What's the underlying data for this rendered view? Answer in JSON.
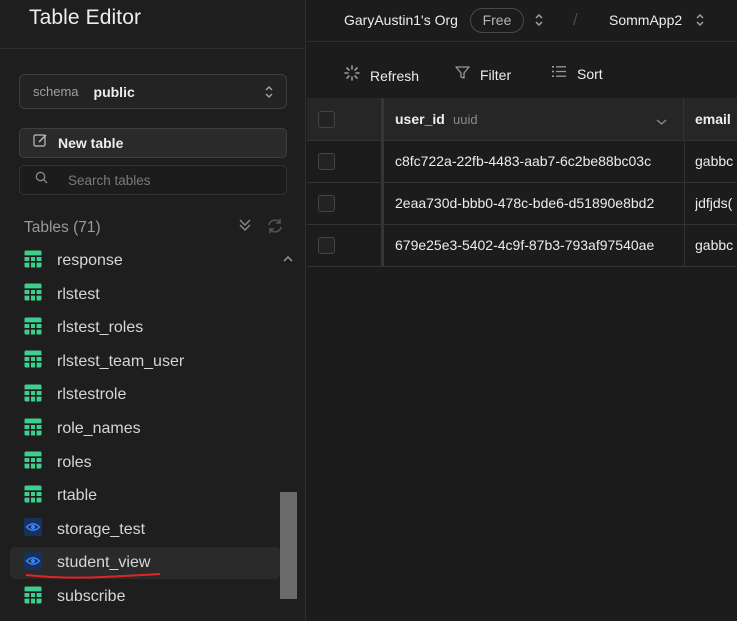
{
  "sidebar": {
    "title": "Table Editor",
    "schema": {
      "label": "schema",
      "value": "public"
    },
    "new_table_label": "New table",
    "search": {
      "placeholder": "Search tables"
    },
    "tables_header": "Tables (71)",
    "items": [
      {
        "label": "response",
        "icon": "table-icon"
      },
      {
        "label": "rlstest",
        "icon": "table-icon"
      },
      {
        "label": "rlstest_roles",
        "icon": "table-icon"
      },
      {
        "label": "rlstest_team_user",
        "icon": "table-icon"
      },
      {
        "label": "rlstestrole",
        "icon": "table-icon"
      },
      {
        "label": "role_names",
        "icon": "table-icon"
      },
      {
        "label": "roles",
        "icon": "table-icon"
      },
      {
        "label": "rtable",
        "icon": "table-icon"
      },
      {
        "label": "storage_test",
        "icon": "view-icon"
      },
      {
        "label": "student_view",
        "icon": "view-icon",
        "active": true
      },
      {
        "label": "subscribe",
        "icon": "table-icon"
      }
    ]
  },
  "topbar": {
    "org_name": "GaryAustin1's Org",
    "plan": "Free",
    "separator": "/",
    "project_name": "SommApp2"
  },
  "toolbar": {
    "refresh_label": "Refresh",
    "filter_label": "Filter",
    "sort_label": "Sort"
  },
  "grid": {
    "columns": [
      {
        "name": "user_id",
        "type": "uuid"
      },
      {
        "name": "email",
        "type": ""
      }
    ],
    "rows": [
      {
        "user_id": "c8fc722a-22fb-4483-aab7-6c2be88bc03c",
        "email": "gabbc"
      },
      {
        "user_id": "2eaa730d-bbb0-478c-bde6-d51890e8bd2",
        "email": "jdfjds("
      },
      {
        "user_id": "679e25e3-5402-4c9f-87b3-793af97540ae",
        "email": "gabbc"
      }
    ]
  },
  "colors": {
    "table_icon": "#3ecf8e",
    "view_icon": "#3b82f6",
    "annotation": "#e0242b"
  }
}
